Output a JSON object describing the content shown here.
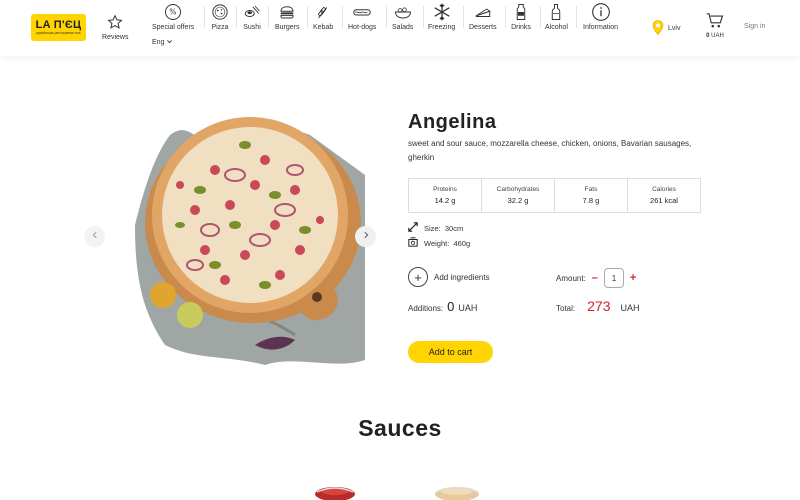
{
  "header": {
    "logo_text": "LA П'ЄЦ",
    "logo_sub": "українська ресторанна сіль",
    "nav": [
      {
        "label": "Reviews",
        "icon": "star-icon"
      },
      {
        "label": "Special offers",
        "icon": "percent-icon"
      },
      {
        "label": "Pizza",
        "icon": "pizza-icon"
      },
      {
        "label": "Sushi",
        "icon": "sushi-icon"
      },
      {
        "label": "Burgers",
        "icon": "burger-icon"
      },
      {
        "label": "Kebab",
        "icon": "kebab-icon"
      },
      {
        "label": "Hot-dogs",
        "icon": "hotdog-icon"
      },
      {
        "label": "Salads",
        "icon": "salad-icon"
      },
      {
        "label": "Freezing",
        "icon": "snowflake-icon"
      },
      {
        "label": "Desserts",
        "icon": "dessert-icon"
      },
      {
        "label": "Drinks",
        "icon": "drink-icon"
      },
      {
        "label": "Alcohol",
        "icon": "alcohol-icon"
      },
      {
        "label": "Information",
        "icon": "info-icon"
      }
    ],
    "language": "Eng",
    "city": "Lviv",
    "cart_amount": "0",
    "cart_currency": "UAH",
    "signin": "Sign in"
  },
  "product": {
    "name": "Angelina",
    "description": "sweet and sour sauce, mozzarella cheese, chicken, onions, Bavarian sausages, gherkin",
    "nutrition": [
      {
        "name": "Proteins",
        "value": "14.2 g"
      },
      {
        "name": "Carbohydrates",
        "value": "32.2 g"
      },
      {
        "name": "Fats",
        "value": "7.8 g"
      },
      {
        "name": "Calories",
        "value": "261 kcal"
      }
    ],
    "size_label": "Size:",
    "size_value": "30cm",
    "weight_label": "Weight:",
    "weight_value": "460g",
    "add_ingredients": "Add ingredients",
    "amount_label": "Amount:",
    "amount_value": "1",
    "additions_label": "Additions:",
    "additions_value": "0",
    "additions_currency": "UAH",
    "total_label": "Total:",
    "total_value": "273",
    "total_currency": "UAH",
    "add_to_cart": "Add to cart"
  },
  "sauces_title": "Sauces",
  "colors": {
    "accent": "#ffd400",
    "price": "#d2232a"
  }
}
